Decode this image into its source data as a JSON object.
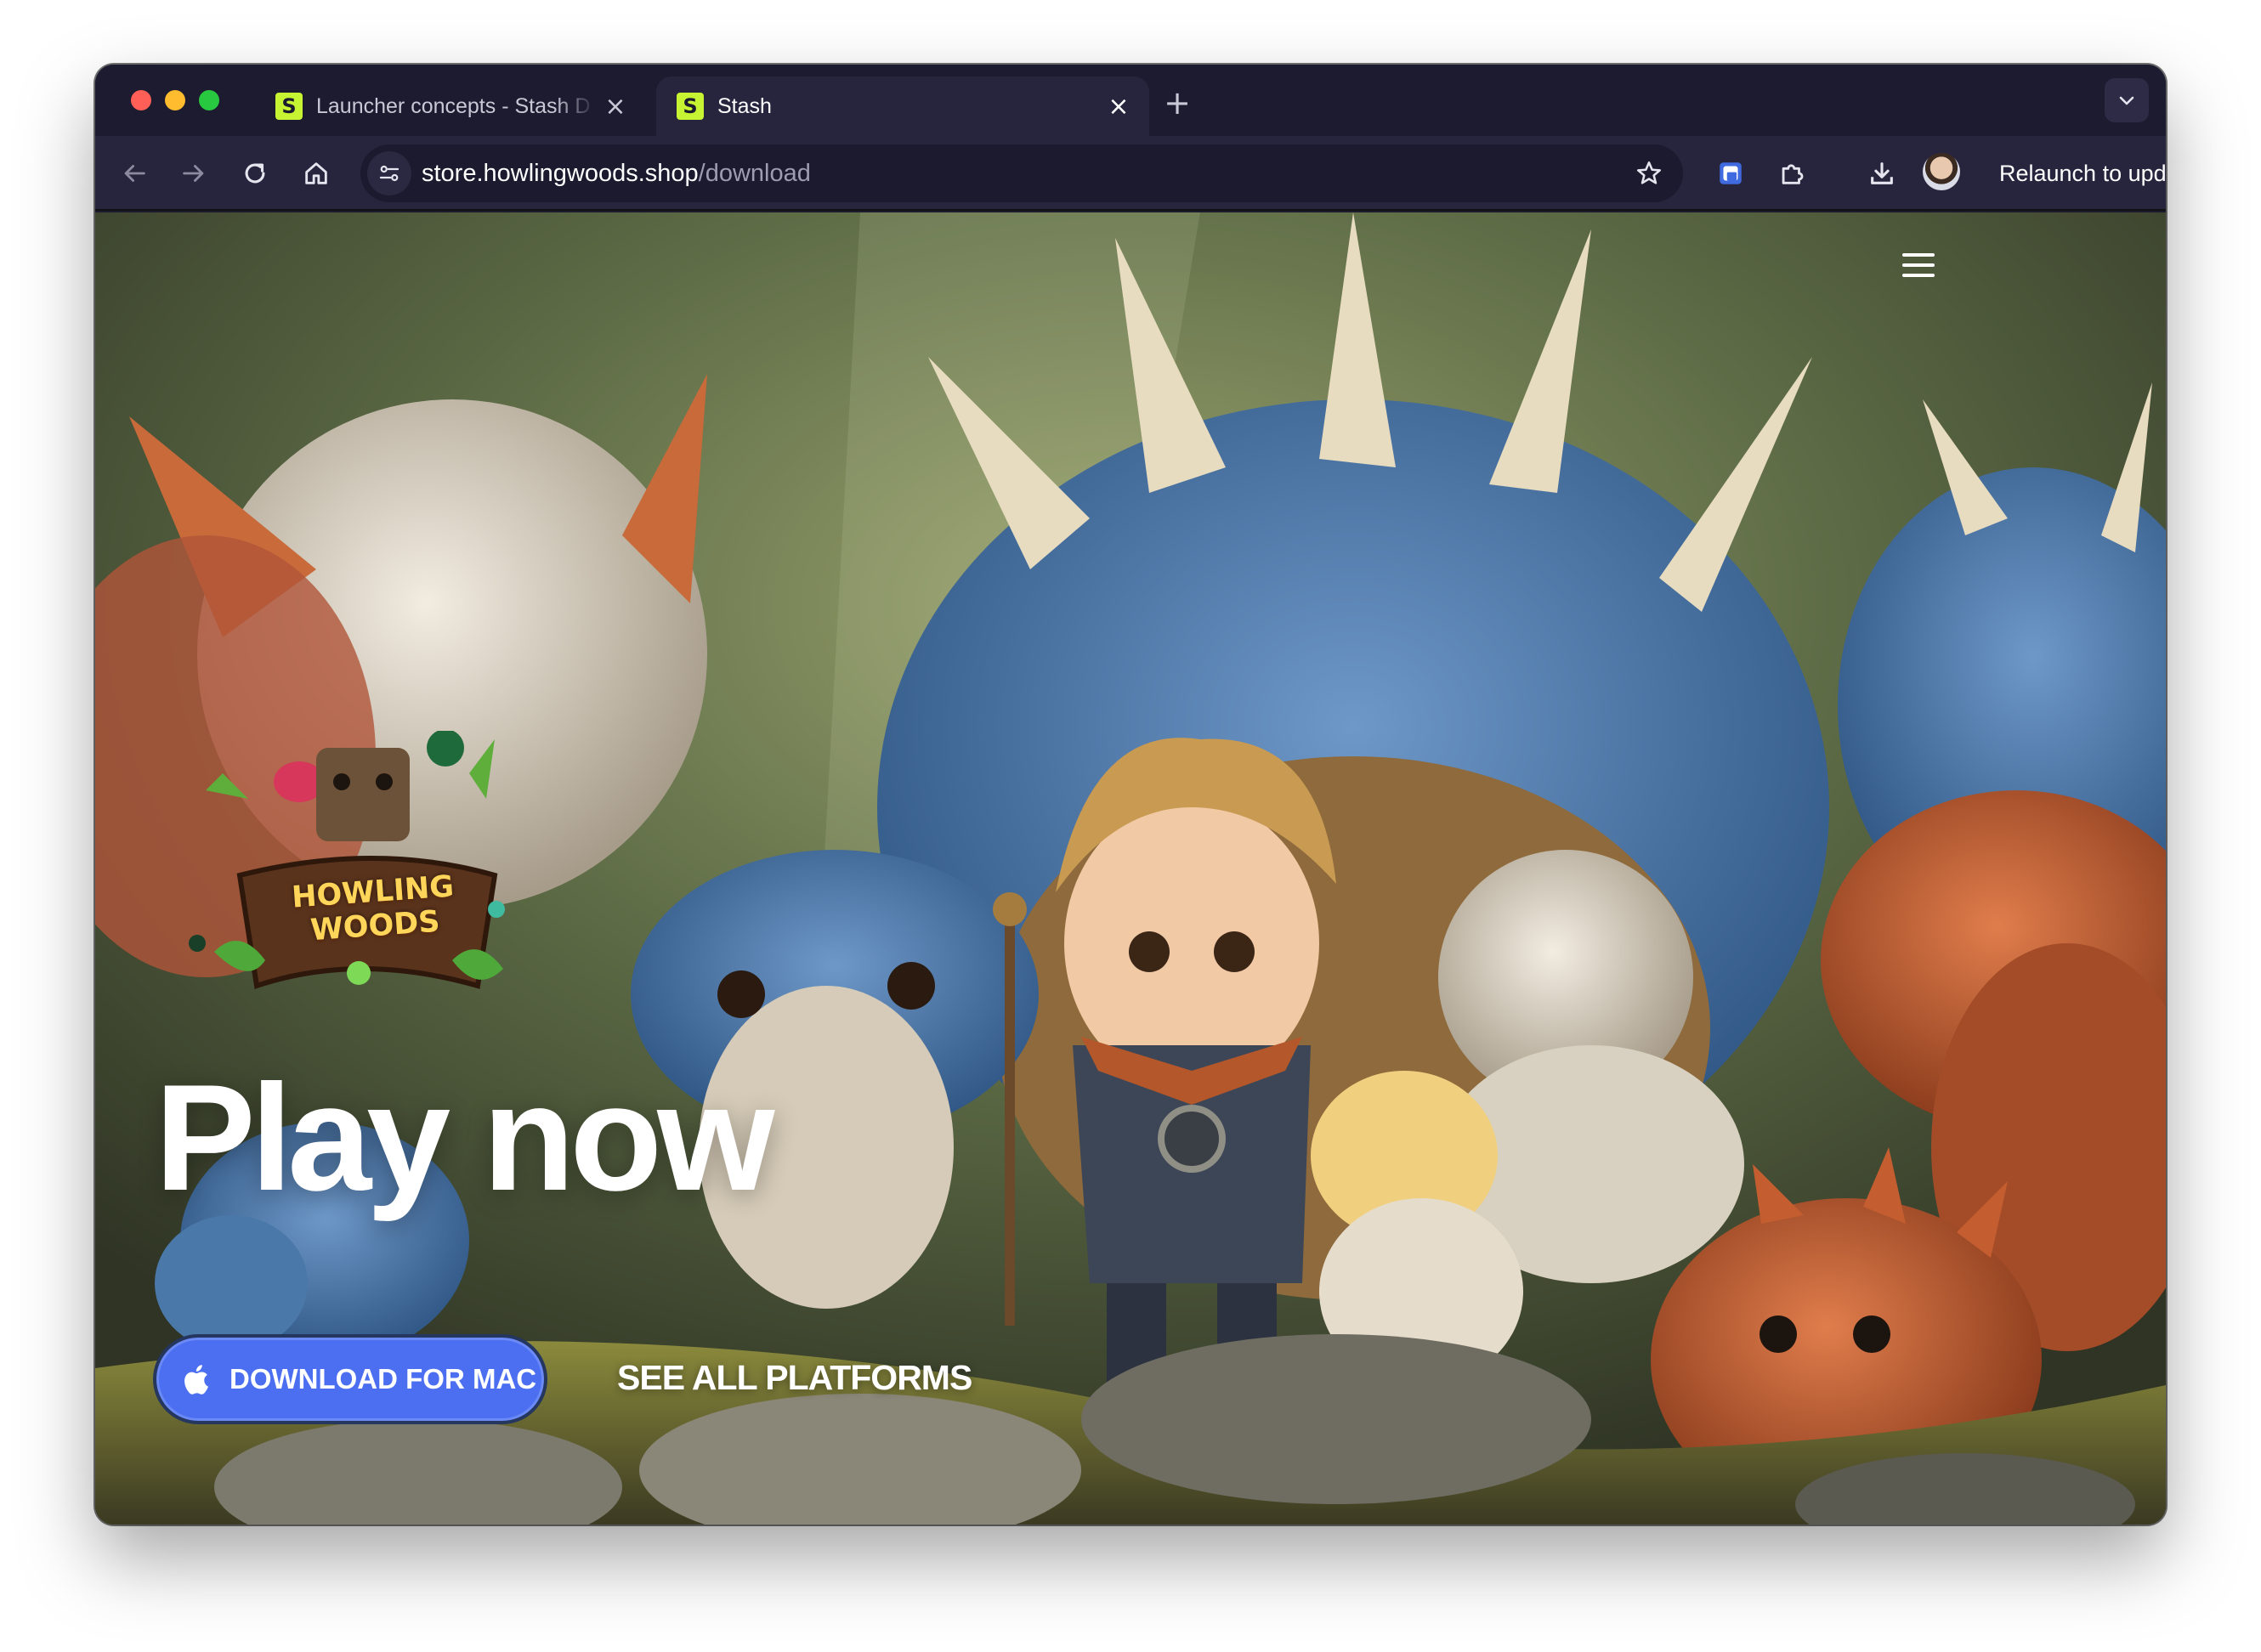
{
  "browser": {
    "tabs": [
      {
        "title": "Launcher concepts - Stash D",
        "favicon": "stash-logo-icon",
        "active": false
      },
      {
        "title": "Stash",
        "favicon": "stash-logo-icon",
        "active": true
      }
    ],
    "tab_close_glyph": "×",
    "new_tab_glyph": "+",
    "favicon_glyph": "S",
    "url_host": "store.howlingwoods.shop",
    "url_path": "/download",
    "relaunch_label": "Relaunch to update",
    "icons": [
      "back-icon",
      "forward-icon",
      "reload-icon",
      "home-icon",
      "site-info-icon",
      "bookmark-star-icon",
      "password-manager-icon",
      "extensions-icon",
      "download-icon",
      "avatar",
      "more-icon",
      "tab-search-icon"
    ],
    "colors": {
      "frame": "#1c1b2f",
      "toolbar": "#27253d",
      "favicon": "#c6f432"
    }
  },
  "page": {
    "logo": {
      "line1": "HOWLING",
      "line2": "WOODS"
    },
    "headline": "Play now",
    "download_button": {
      "label": "DOWNLOAD FOR MAC",
      "icon": "apple-icon"
    },
    "see_all_label": "SEE ALL PLATFORMS",
    "menu_icon": "hamburger-menu-icon",
    "colors": {
      "download_button": "#4b6ff0",
      "logo_text": "#ffd659",
      "headline": "#ffffff"
    }
  }
}
